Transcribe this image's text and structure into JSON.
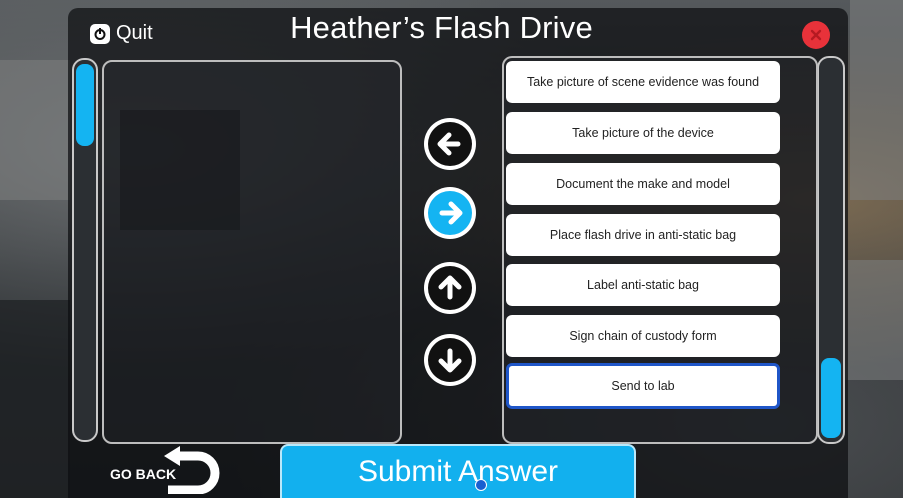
{
  "header": {
    "title": "Heather’s Flash Drive",
    "quit_label": "Quit"
  },
  "steps": [
    {
      "label": "Take picture of scene evidence was found"
    },
    {
      "label": "Take picture of the device"
    },
    {
      "label": "Document the make and model"
    },
    {
      "label": "Place flash drive in anti-static bag"
    },
    {
      "label": "Label anti-static bag"
    },
    {
      "label": "Sign chain of custody form"
    },
    {
      "label": "Send to lab",
      "selected": true
    }
  ],
  "controls": {
    "move_left_icon": "arrow-left-icon",
    "move_right_icon": "arrow-right-icon",
    "move_up_icon": "arrow-up-icon",
    "move_down_icon": "arrow-down-icon"
  },
  "footer": {
    "go_back_label": "GO BACK",
    "submit_label": "Submit Answer"
  },
  "colors": {
    "accent": "#14b4f2",
    "close": "#e8323a",
    "selected_border": "#1f56c8"
  }
}
